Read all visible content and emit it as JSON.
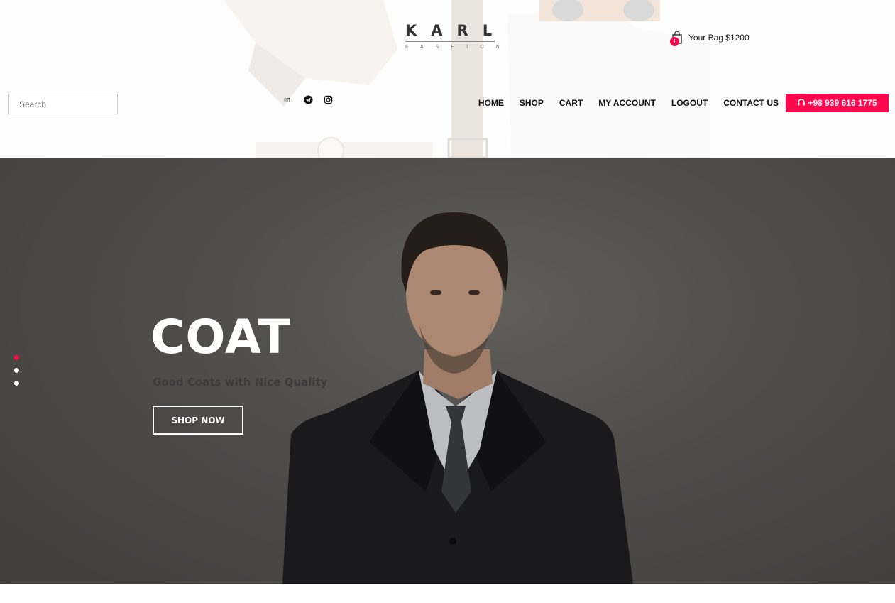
{
  "logo": {
    "main": "KARL",
    "sub": "FASHION"
  },
  "bag": {
    "count": "1",
    "label": "Your Bag $1200",
    "icon": "bag-icon"
  },
  "search": {
    "placeholder": "Search"
  },
  "social": [
    {
      "name": "linkedin",
      "glyph": "in"
    },
    {
      "name": "telegram",
      "icon": "telegram-icon"
    },
    {
      "name": "instagram",
      "icon": "instagram-icon"
    }
  ],
  "nav": {
    "items": [
      {
        "label": "HOME"
      },
      {
        "label": "SHOP"
      },
      {
        "label": "CART"
      },
      {
        "label": "MY ACCOUNT"
      },
      {
        "label": "LOGOUT"
      },
      {
        "label": "CONTACT US"
      }
    ],
    "phone": "+98 939 616 1775"
  },
  "hero": {
    "title": "COAT",
    "subtitle": "Good Coats with Nice Quality",
    "button": "SHOP NOW",
    "slides": 3,
    "active_slide": 1
  },
  "colors": {
    "accent": "#ff084e",
    "text": "#111111",
    "hero_bg": "#5a5854"
  }
}
